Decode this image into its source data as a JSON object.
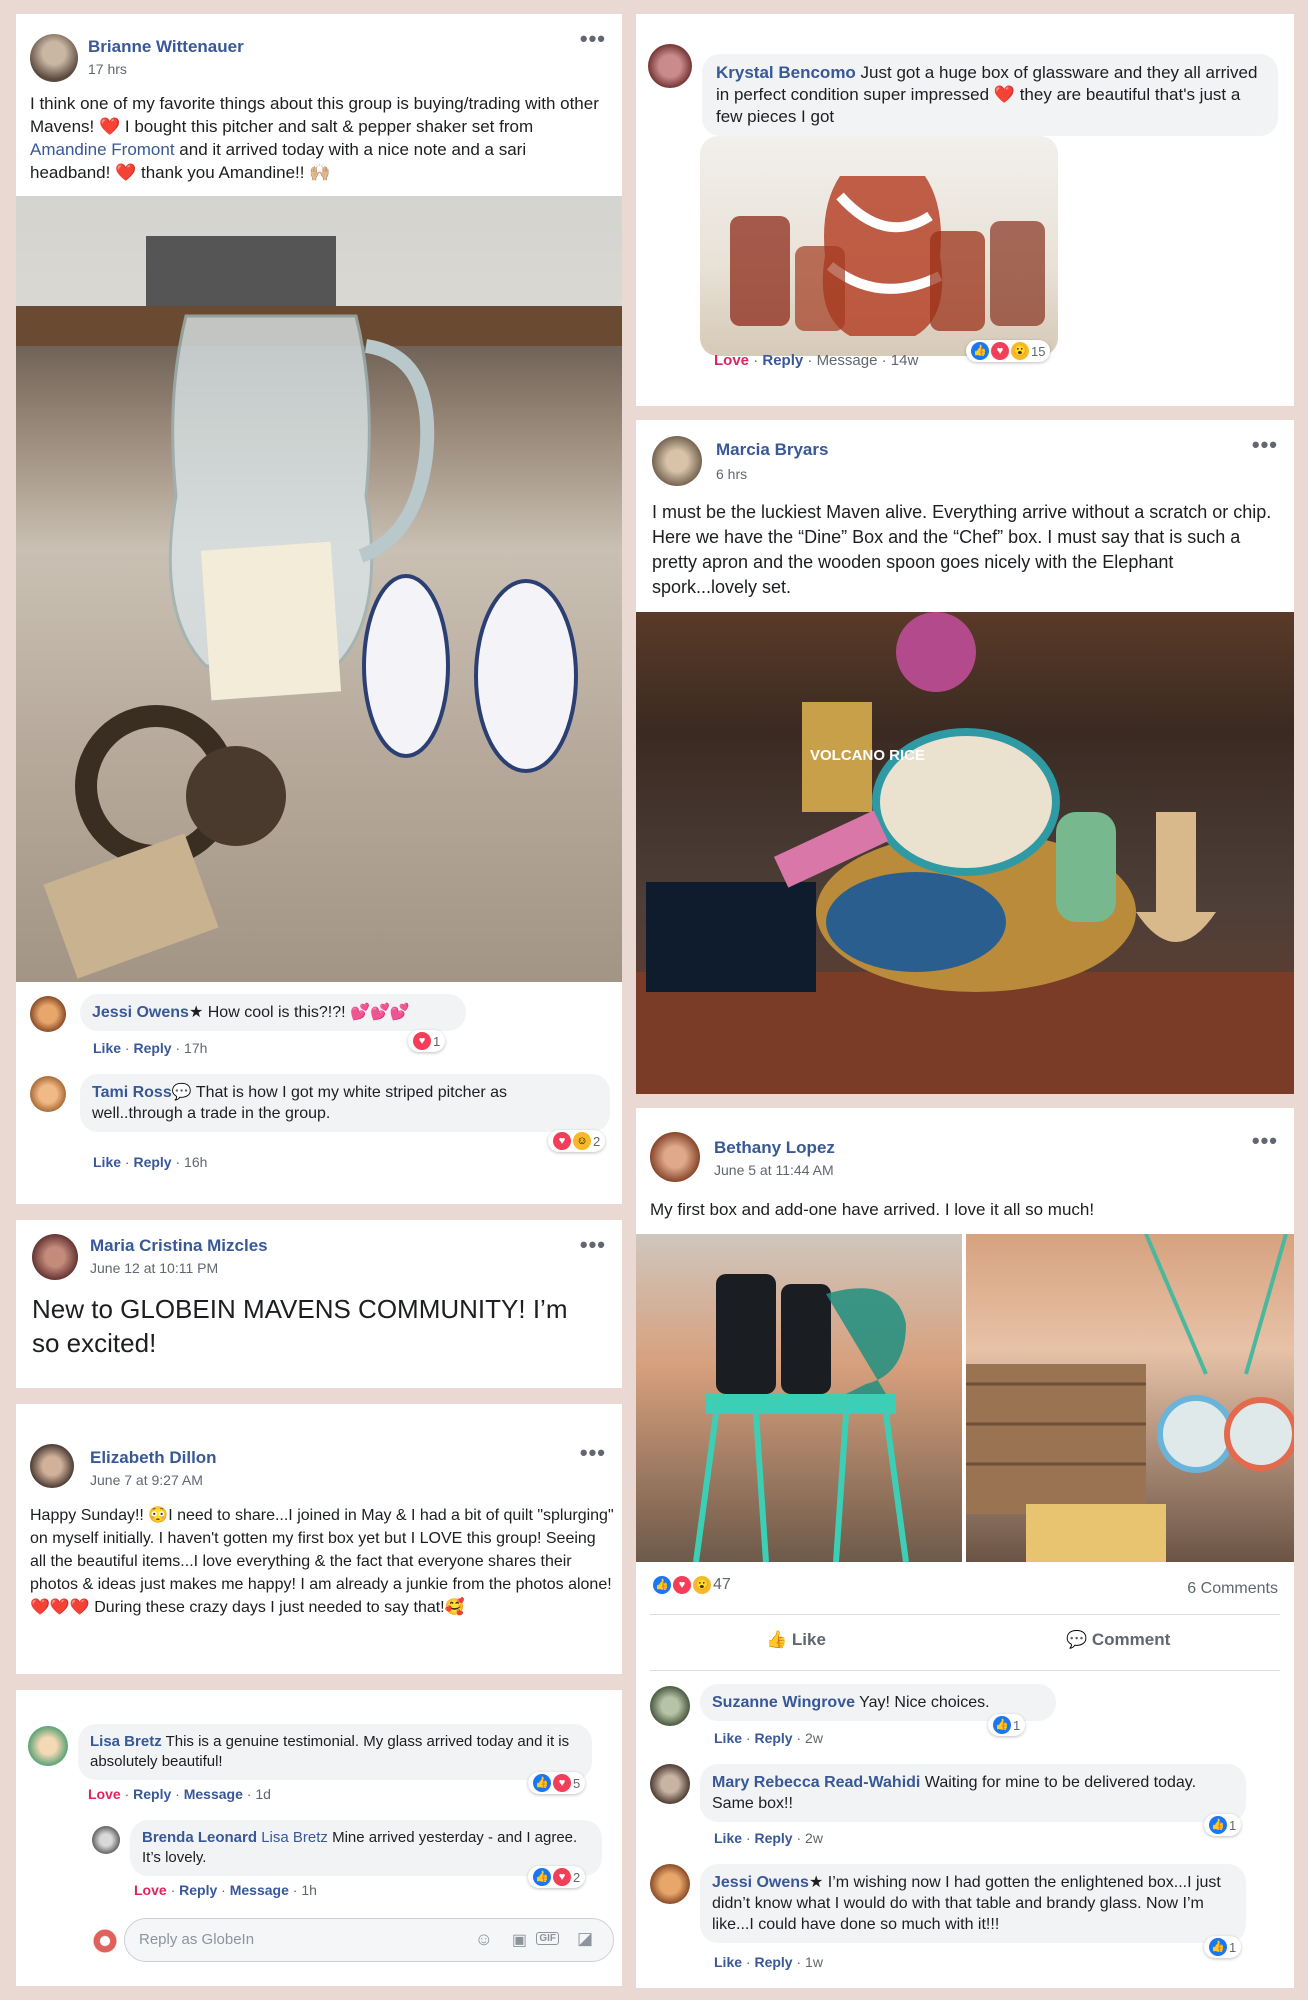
{
  "brianne_post": {
    "author": "Brianne Wittenauer",
    "time": "17 hrs",
    "text_1": "I think one of my favorite things about this group is buying/trading with other Mavens! ",
    "heart": "❤️",
    "text_2": " I bought this pitcher and salt & pepper shaker set from ",
    "mention": "Amandine Fromont",
    "text_3": " and it arrived today with a nice note and a sari headband! ",
    "text_4": " thank you Amandine!! 🙌🏼",
    "more": "•••",
    "comments": [
      {
        "author": "Jessi Owens",
        "badge": "★",
        "text": " How cool is this?!?! 💕💕💕",
        "actions": [
          "Like",
          "Reply",
          "17h"
        ],
        "reactions": "1"
      },
      {
        "author": "Tami Ross",
        "badge": "💬",
        "text": " That is how I got my white striped pitcher as well..through a trade in the group.",
        "actions": [
          "Like",
          "Reply",
          "16h"
        ],
        "reactions": "2"
      }
    ]
  },
  "krystal_comment": {
    "author": "Krystal Bencomo",
    "text_1": " Just got a huge box of glassware and they all arrived in perfect condition super impressed ",
    "heart": "❤️",
    "text_2": " they are beautiful that's just a few pieces I got",
    "actions": [
      "Love",
      "Reply",
      "Message",
      "14w"
    ],
    "reactions": "15"
  },
  "marcia_post": {
    "author": "Marcia Bryars",
    "time": "6 hrs",
    "more": "•••",
    "text": "I must be the luckiest Maven alive. Everything arrive without a scratch or chip. Here we have the “Dine” Box and the “Chef” box. I must say that is such a pretty apron and the wooden spoon goes nicely with the Elephant spork...lovely set.",
    "photo_labels": [
      "VOLCANO RICE"
    ]
  },
  "maria_post": {
    "author": "Maria Cristina Mizcles",
    "time": "June 12 at 10:11 PM",
    "more": "•••",
    "text": "New to GLOBEIN MAVENS COMMUNITY! I’m so excited!"
  },
  "bethany_post": {
    "author": "Bethany Lopez",
    "time": "June 5 at 11:44 AM",
    "more": "•••",
    "text": "My first box and add-one have arrived. I love it all so much!",
    "reaction_count": "47",
    "comment_count": "6 Comments",
    "like_label": "Like",
    "comment_label": "Comment",
    "comments": [
      {
        "author": "Suzanne Wingrove",
        "text": " Yay! Nice choices.",
        "actions": [
          "Like",
          "Reply",
          "2w"
        ],
        "reactions": "1"
      },
      {
        "author": "Mary Rebecca Read-Wahidi",
        "text": " Waiting for mine to be delivered today. Same box!!",
        "actions": [
          "Like",
          "Reply",
          "2w"
        ],
        "reactions": "1"
      },
      {
        "author": "Jessi Owens",
        "badge": "★",
        "text": " I’m wishing now I had gotten the enlightened box...I just didn’t know what I would do with that table and brandy glass. Now I’m like...I could have done so much with it!!!",
        "actions": [
          "Like",
          "Reply",
          "1w"
        ],
        "reactions": "1"
      }
    ]
  },
  "elizabeth_post": {
    "author": "Elizabeth Dillon",
    "time": "June 7 at 9:27 AM",
    "more": "•••",
    "text_1": "Happy Sunday!! 😳I need to share...I joined in May & I had a bit of quilt \"splurging\" on myself initially. I haven't gotten my first box yet but I LOVE this group! Seeing all the beautiful items...I love everything & the fact that everyone shares their photos & ideas just makes me happy! I am already a junkie from the photos alone! ",
    "hearts": "❤️❤️❤️",
    "text_2": " During these crazy days I just needed to say that!🥰"
  },
  "lisa_thread": {
    "comment": {
      "author": "Lisa Bretz",
      "text": " This is a genuine testimonial. My glass arrived today and it is absolutely beautiful!",
      "actions": [
        "Love",
        "Reply",
        "Message",
        "1d"
      ],
      "reactions": "5"
    },
    "reply": {
      "author": "Brenda Leonard",
      "mention": " Lisa Bretz",
      "text": " Mine arrived yesterday - and I agree. It’s lovely.",
      "actions": [
        "Love",
        "Reply",
        "Message",
        "1h"
      ],
      "reactions": "2"
    },
    "reply_placeholder": "Reply as GlobeIn"
  },
  "colors": {
    "link": "#385898",
    "love": "#e0245e",
    "bg": "#ead9d2"
  }
}
